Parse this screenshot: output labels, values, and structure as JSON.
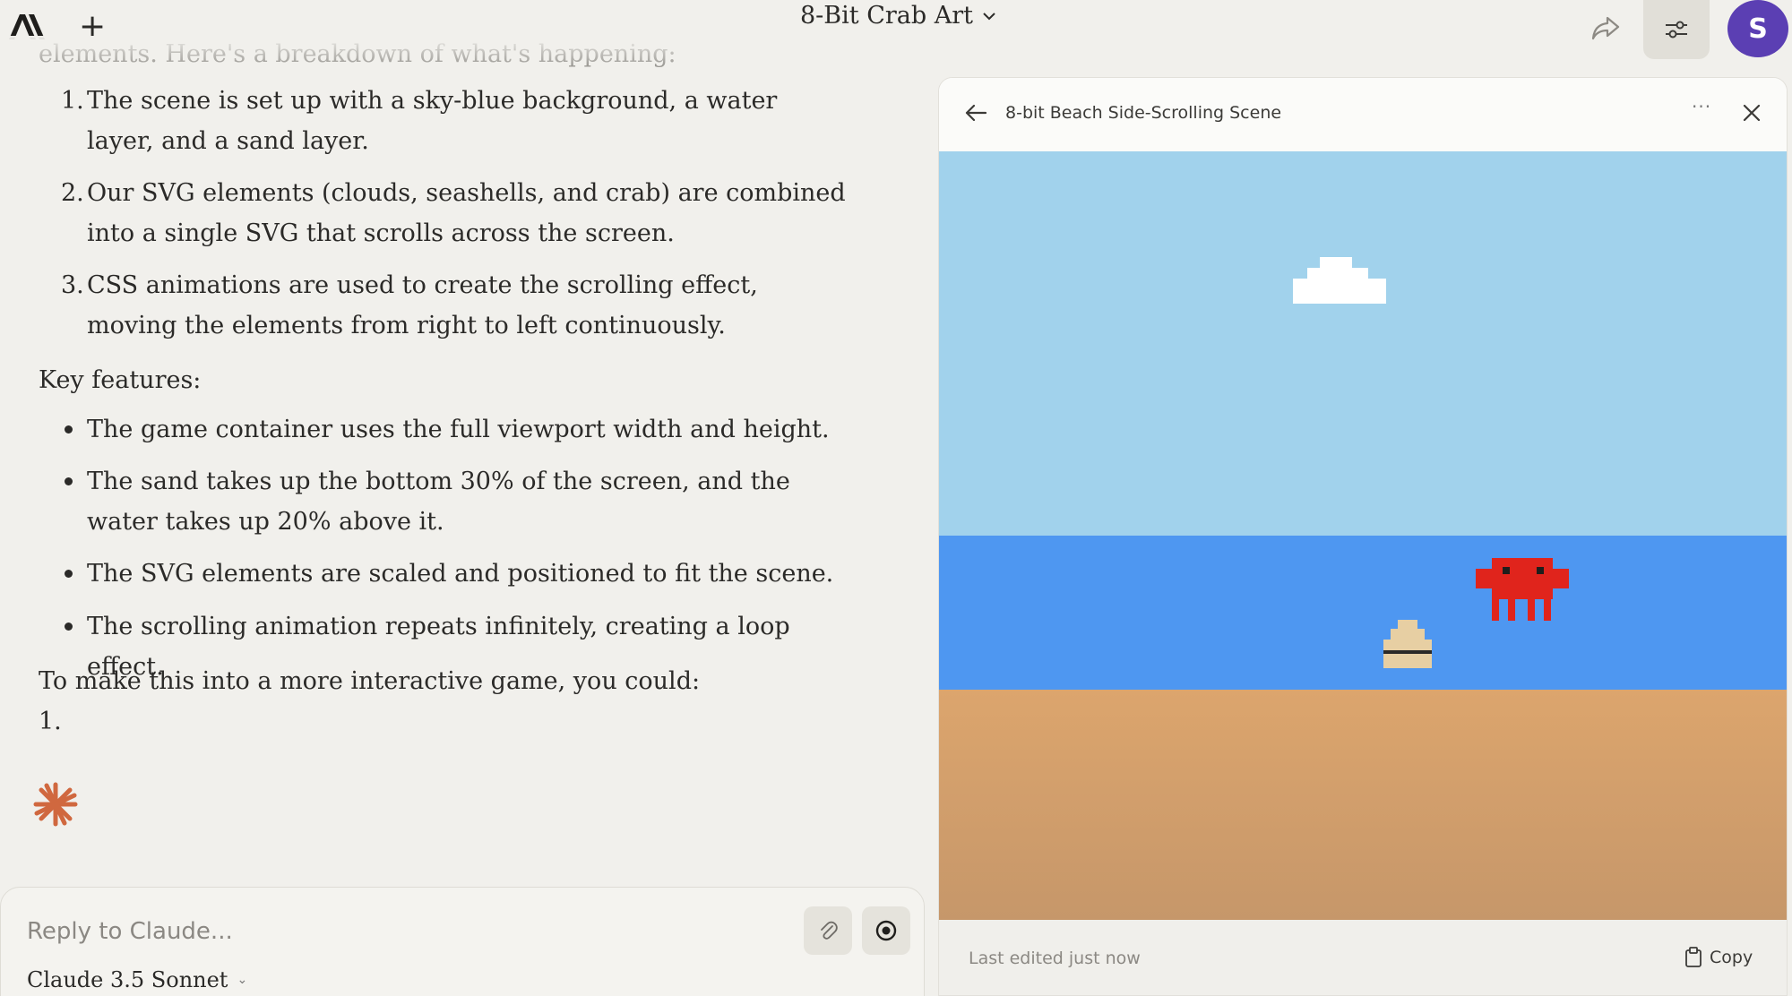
{
  "header": {
    "conversation_title": "8-Bit Crab Art",
    "avatar_initial": "S",
    "icons": {
      "logo": "anthropic-logo",
      "new_chat": "plus-icon",
      "share": "share-icon",
      "settings": "sliders-icon"
    }
  },
  "chat": {
    "partial_intro": "elements. Here's a breakdown of what's happening:",
    "steps": [
      {
        "num": "1.",
        "text": "The scene is set up with a sky-blue background, a water layer, and a sand layer."
      },
      {
        "num": "2.",
        "text": "Our SVG elements (clouds, seashells, and crab) are combined into a single SVG that scrolls across the screen."
      },
      {
        "num": "3.",
        "text": "CSS animations are used to create the scrolling effect, moving the elements from right to left continuously."
      }
    ],
    "features_heading": "Key features:",
    "features": [
      "The game container uses the full viewport width and height.",
      "The sand takes up the bottom 30% of the screen, and the water takes up 20% above it.",
      "The SVG elements are scaled and positioned to fit the scene.",
      "The scrolling animation repeats infinitely, creating a loop effect."
    ],
    "interactive_heading": "To make this into a more interactive game, you could:",
    "partial_list_start": "1."
  },
  "composer": {
    "placeholder": "Reply to Claude...",
    "model": "Claude 3.5 Sonnet"
  },
  "artifact": {
    "title": "8-bit Beach Side-Scrolling Scene",
    "more_label": "···",
    "footer_status": "Last edited just now",
    "copy_label": "Copy",
    "colors": {
      "sky": "#a1d2ec",
      "water": "#4e97f1",
      "sand": "#dca56d",
      "crab": "#e0241c",
      "cloud": "#ffffff",
      "shell": "#e7cfa3"
    }
  }
}
